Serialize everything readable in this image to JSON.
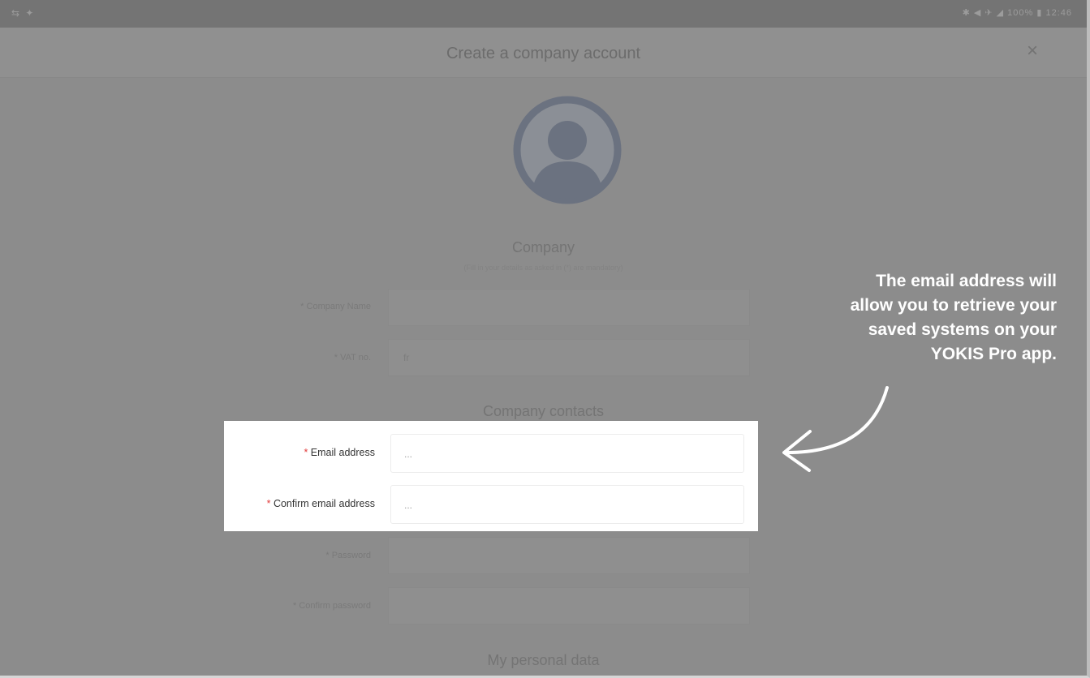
{
  "status_bar": {
    "left": "⇆ ✦",
    "right": "✱ ◀ ✈ ◢ 100% ▮ 12:46"
  },
  "header": {
    "title": "Create a company account",
    "close_glyph": "×"
  },
  "company_section": {
    "heading": "Company",
    "subtitle": "(Fill in your details as asked in (*) are mandatory)",
    "fields": [
      {
        "label": "* Company Name",
        "value": ""
      },
      {
        "label": "* VAT no.",
        "value": "fr"
      }
    ]
  },
  "contacts_section": {
    "heading": "Company contacts",
    "fields": [
      {
        "label_req": "*",
        "label": " Email address",
        "value": "..."
      },
      {
        "label_req": "*",
        "label": " Confirm email address",
        "value": "..."
      }
    ],
    "password_fields": [
      {
        "label": "* Password",
        "value": ""
      },
      {
        "label": "* Confirm password",
        "value": ""
      }
    ]
  },
  "personal_section": {
    "heading": "My personal data"
  },
  "callout": {
    "line1": "The email address will",
    "line2": "allow you to retrieve your",
    "line3": "saved systems on your",
    "line4": "YOKIS Pro app."
  },
  "colors": {
    "required": "#e23b3b",
    "overlay": "#8c8c8c",
    "highlight_bg": "#ffffff",
    "callout_text": "#ffffff"
  }
}
